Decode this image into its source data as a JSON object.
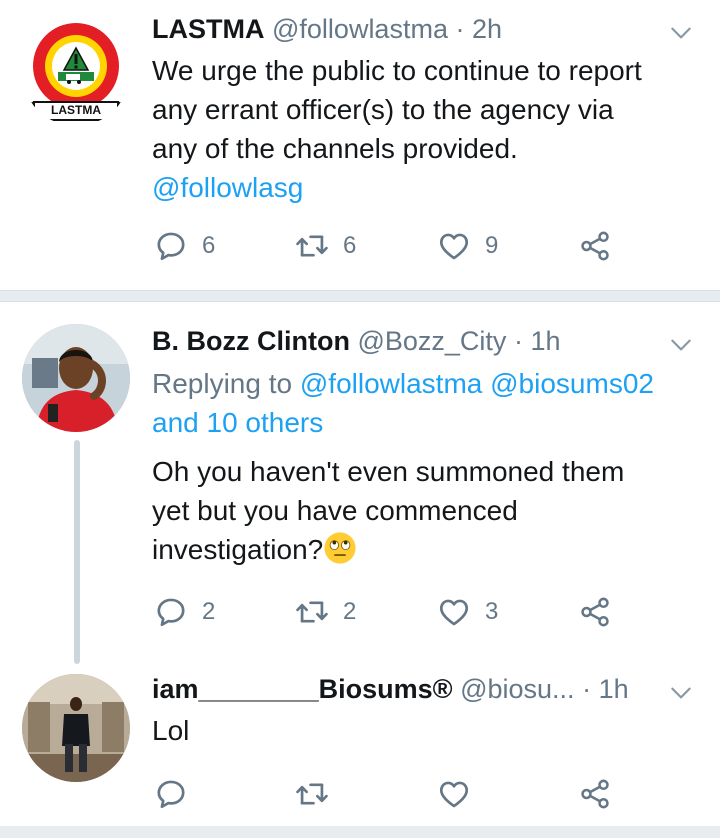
{
  "tweets": [
    {
      "name": "LASTMA",
      "handle": "@followlastma",
      "dot": "·",
      "time": "2h",
      "avatar_logo_text": "LASTMA",
      "text_lines": [
        "We urge the public to continue to report",
        "any errant officer(s) to the agency via",
        "any of the channels provided."
      ],
      "mention": "@followlasg",
      "replies": "6",
      "retweets": "6",
      "likes": "9"
    },
    {
      "name": "B. Bozz Clinton",
      "handle": "@Bozz_City",
      "dot": "·",
      "time": "1h",
      "replying_prefix": "Replying to",
      "replying_users": "@followlastma @biosums02",
      "replying_others": "and 10 others",
      "text_lines": [
        "Oh you haven't even summoned them",
        "yet but you have commenced",
        "investigation?"
      ],
      "emoji": "🙄",
      "replies": "2",
      "retweets": "2",
      "likes": "3"
    },
    {
      "name": "iam________Biosums®",
      "handle": "@biosu...",
      "dot": "·",
      "time": "1h",
      "text": "Lol"
    }
  ],
  "colors": {
    "accent": "#1da1f2",
    "secondary_text": "#657786",
    "icon": "#657786",
    "divider": "#e6ecf0"
  },
  "icons": {
    "reply": "reply-icon",
    "retweet": "retweet-icon",
    "like": "heart-icon",
    "share": "share-icon",
    "menu": "chevron-down-icon"
  }
}
